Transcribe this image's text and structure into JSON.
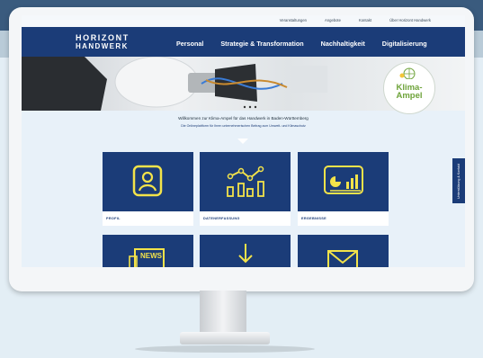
{
  "topnav": [
    "Veranstaltungen",
    "Angebote",
    "Kontakt",
    "Über Horizont Handwerk"
  ],
  "logo": {
    "line1": "HORIZONT",
    "line2": "HANDWERK"
  },
  "mainnav": [
    "Personal",
    "Strategie & Transformation",
    "Nachhaltigkeit",
    "Digitalisierung"
  ],
  "badge": {
    "line1": "Klima-",
    "line2": "Ampel"
  },
  "welcome": {
    "title": "Willkommen zur Klima-Ampel für das Handwerk in Baden-Württemberg",
    "subtitle": "Die Onlineplattform für Ihren unternehmerischen Beitrag zum Umwelt- und Klimaschutz"
  },
  "tiles": [
    {
      "label": "PROFIL",
      "icon": "profile-icon"
    },
    {
      "label": "DATENERFASSUNG",
      "icon": "data-chart-icon"
    },
    {
      "label": "ERGEBNISSE",
      "icon": "results-dashboard-icon"
    }
  ],
  "tiles_bottom": [
    {
      "icon": "news-icon",
      "text": "NEWS"
    },
    {
      "icon": "download-arrow-icon"
    },
    {
      "icon": "mail-icon"
    }
  ],
  "side_button": "Unterstützung & Kontakt",
  "colors": {
    "navy": "#1b3c78",
    "yellow": "#f3e34a",
    "green": "#6ea33a"
  }
}
